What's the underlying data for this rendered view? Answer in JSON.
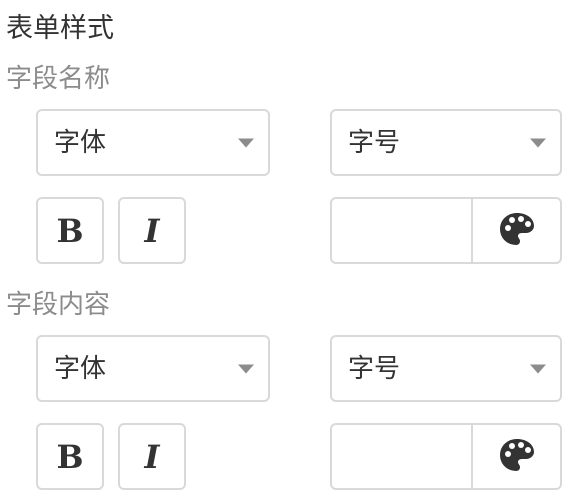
{
  "page": {
    "title": "表单样式"
  },
  "sections": [
    {
      "label": "字段名称",
      "font_select": {
        "value": "字体"
      },
      "size_select": {
        "value": "字号"
      },
      "bold_label": "B",
      "italic_label": "I",
      "color_input": {
        "value": ""
      }
    },
    {
      "label": "字段内容",
      "font_select": {
        "value": "字体"
      },
      "size_select": {
        "value": "字号"
      },
      "bold_label": "B",
      "italic_label": "I",
      "color_input": {
        "value": ""
      }
    }
  ],
  "icons": {
    "color_picker": "palette-icon"
  },
  "colors": {
    "border": "#d9d9d9",
    "label_gray": "#8c8c8c",
    "text": "#333333"
  }
}
